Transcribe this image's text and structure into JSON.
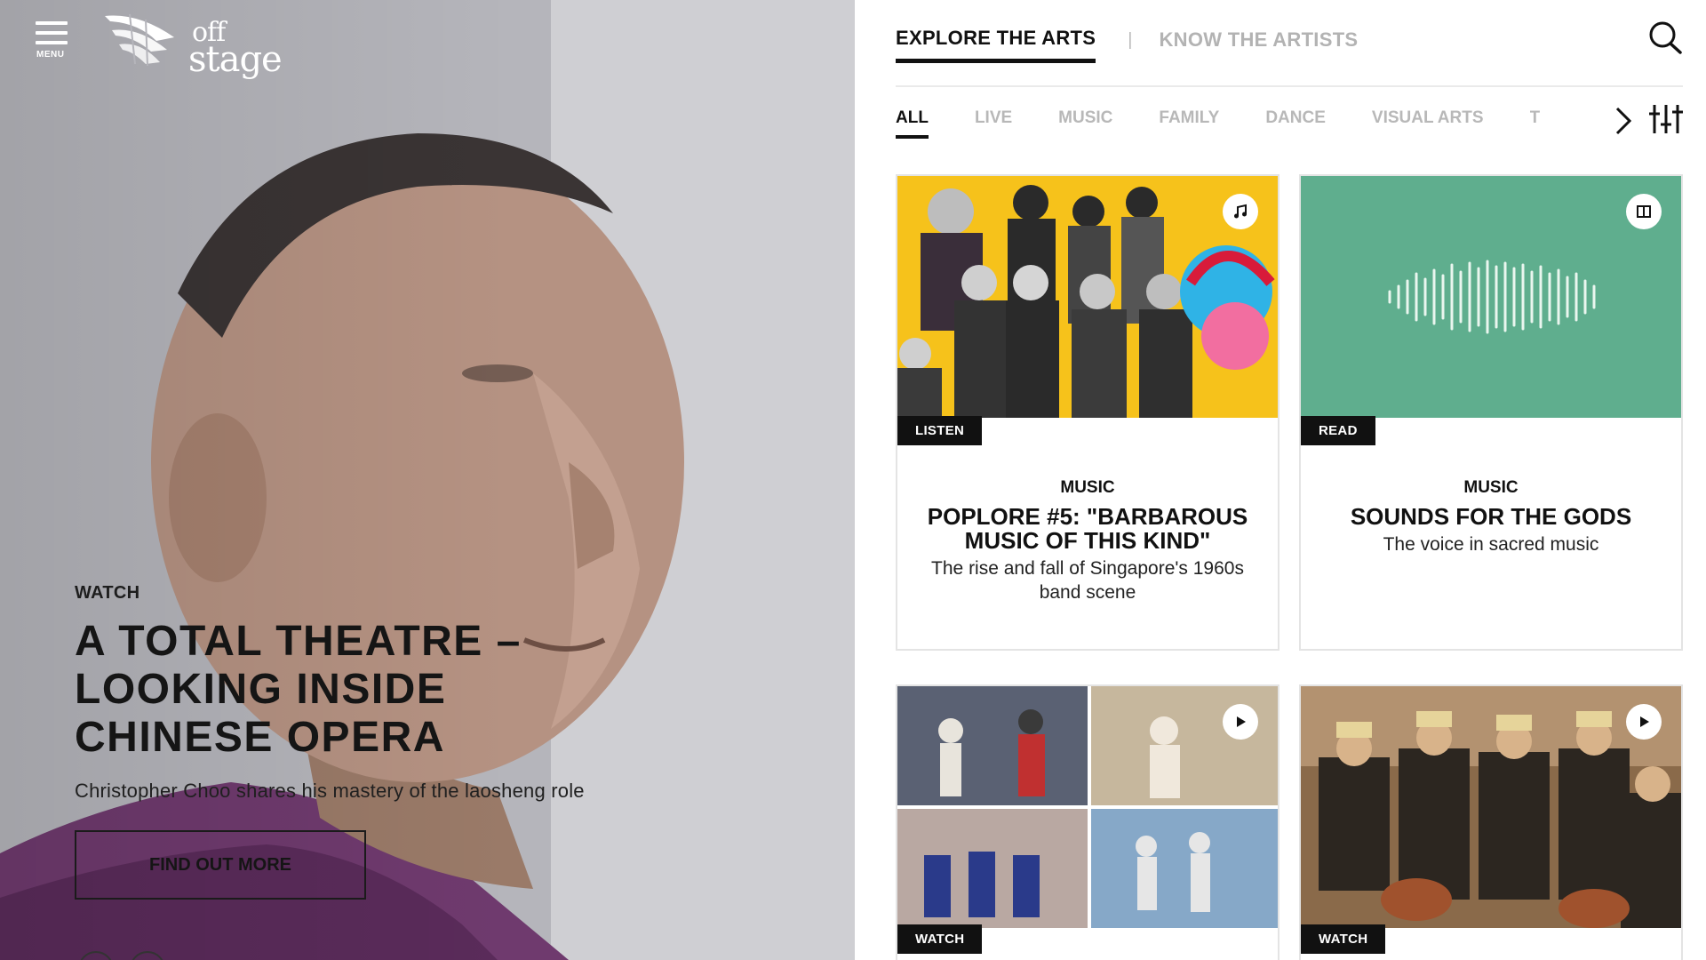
{
  "header": {
    "menu_label": "MENU",
    "logo_text_top": "off",
    "logo_text_bottom": "stage"
  },
  "hero": {
    "kicker": "WATCH",
    "title": "A TOTAL THEATRE – LOOKING INSIDE CHINESE OPERA",
    "subtitle": "Christopher Choo shares his mastery of the laosheng role",
    "cta_label": "FIND OUT MORE",
    "slide_count": 2
  },
  "nav": {
    "tabs": [
      {
        "label": "EXPLORE THE ARTS",
        "active": true
      },
      {
        "label": "KNOW THE ARTISTS",
        "active": false
      }
    ],
    "separator": "|"
  },
  "filters": [
    {
      "label": "ALL",
      "active": true
    },
    {
      "label": "LIVE",
      "active": false
    },
    {
      "label": "MUSIC",
      "active": false
    },
    {
      "label": "FAMILY",
      "active": false
    },
    {
      "label": "DANCE",
      "active": false
    },
    {
      "label": "VISUAL ARTS",
      "active": false
    },
    {
      "label": "T",
      "active": false
    }
  ],
  "cards": [
    {
      "badge": "LISTEN",
      "type_icon": "music-note-icon",
      "category": "MUSIC",
      "title": "POPLORE #5: \"BARBAROUS MUSIC OF THIS KIND\"",
      "description": "The rise and fall of Singapore's 1960s band scene",
      "media_color": "#f6c21b"
    },
    {
      "badge": "READ",
      "type_icon": "book-icon",
      "category": "MUSIC",
      "title": "SOUNDS FOR THE GODS",
      "description": "The voice in sacred music",
      "media_color": "#5fae8e"
    },
    {
      "badge": "WATCH",
      "type_icon": "play-icon"
    },
    {
      "badge": "WATCH",
      "type_icon": "play-icon"
    }
  ],
  "colors": {
    "active_text": "#111111",
    "inactive_text": "#b3b3b3",
    "badge_bg": "#111111"
  }
}
